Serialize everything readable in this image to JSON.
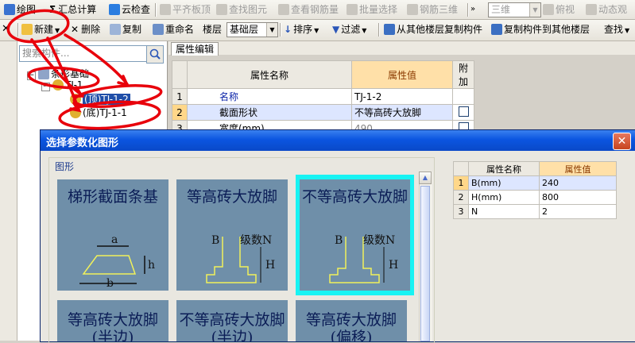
{
  "toolbar_top": {
    "items": [
      "绘图",
      "汇总计算",
      "云检查",
      "平齐板顶",
      "查找图元",
      "查看钢筋量",
      "批量选择",
      "钢筋三维"
    ],
    "view_combo": "三维",
    "view_btn": "俯视",
    "observe_btn": "动态观"
  },
  "toolbar_second": {
    "new_btn": "新建",
    "delete_btn": "删除",
    "copy_btn": "复制",
    "rename_btn": "重命名",
    "floor_label": "楼层",
    "floor_value": "基础层",
    "sort_btn": "排序",
    "filter_btn": "过滤",
    "copy_from_btn": "从其他楼层复制构件",
    "copy_to_btn": "复制构件到其他楼层",
    "find_btn": "查找"
  },
  "left_panel": {
    "search_placeholder": "搜索构件...",
    "tree": {
      "root": "条形基础",
      "child": "TJ-1",
      "leaf_top": "(顶)TJ-1-2",
      "leaf_bottom": "(底)TJ-1-1"
    }
  },
  "property_panel": {
    "tab": "属性编辑",
    "headers": {
      "name": "属性名称",
      "value": "属性值",
      "extra": "附加"
    },
    "rows": [
      {
        "no": "1",
        "name": "名称",
        "value": "TJ-1-2"
      },
      {
        "no": "2",
        "name": "截面形状",
        "value": "不等高砖大放脚"
      },
      {
        "no": "3",
        "name": "宽度(mm)",
        "value": "490"
      }
    ]
  },
  "dialog": {
    "title": "选择参数化图形",
    "close_glyph": "✕",
    "group_label": "图形",
    "tiles": [
      {
        "title": "梯形截面条基"
      },
      {
        "title": "等高砖大放脚"
      },
      {
        "title": "不等高砖大放脚"
      },
      {
        "title": "等高砖大放脚(半边)"
      },
      {
        "title": "不等高砖大放脚(半边)"
      },
      {
        "title": "等高砖大放脚(偏移)"
      }
    ],
    "labels": {
      "a": "a",
      "b": "b",
      "h": "h",
      "B": "B",
      "H": "H",
      "step": "级数N"
    },
    "param_table": {
      "headers": {
        "name": "属性名称",
        "value": "属性值"
      },
      "rows": [
        {
          "no": "1",
          "name": "B(mm)",
          "value": "240"
        },
        {
          "no": "2",
          "name": "H(mm)",
          "value": "800"
        },
        {
          "no": "3",
          "name": "N",
          "value": "2"
        }
      ]
    }
  },
  "colors": {
    "accent": "#0b55e0",
    "selected_tile": "#18f3f3",
    "annotation": "#e8000b"
  }
}
